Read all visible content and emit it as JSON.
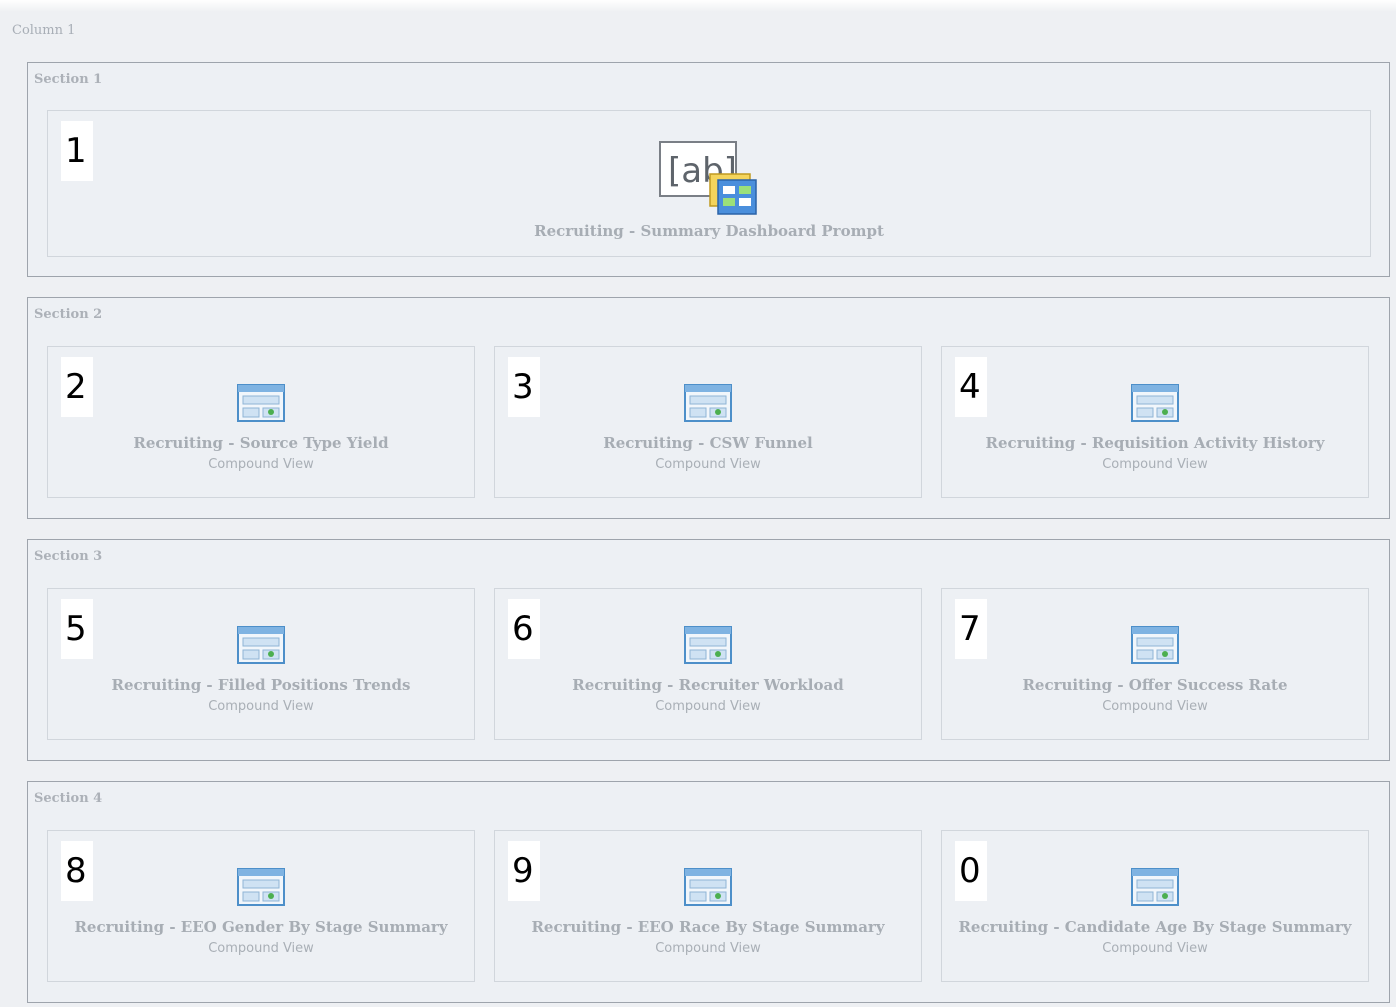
{
  "column": {
    "label": "Column 1"
  },
  "sections": [
    {
      "label": "Section 1",
      "items": [
        {
          "number": "1",
          "title": "Recruiting - Summary Dashboard Prompt",
          "icon": "dashboard-prompt-icon"
        }
      ]
    },
    {
      "label": "Section 2",
      "items": [
        {
          "number": "2",
          "title": "Recruiting - Source Type Yield",
          "subtitle": "Compound View",
          "icon": "compound-view-icon"
        },
        {
          "number": "3",
          "title": "Recruiting - CSW Funnel",
          "subtitle": "Compound View",
          "icon": "compound-view-icon"
        },
        {
          "number": "4",
          "title": "Recruiting - Requisition Activity History",
          "subtitle": "Compound View",
          "icon": "compound-view-icon"
        }
      ]
    },
    {
      "label": "Section 3",
      "items": [
        {
          "number": "5",
          "title": "Recruiting - Filled Positions Trends",
          "subtitle": "Compound View",
          "icon": "compound-view-icon"
        },
        {
          "number": "6",
          "title": "Recruiting - Recruiter Workload",
          "subtitle": "Compound View",
          "icon": "compound-view-icon"
        },
        {
          "number": "7",
          "title": "Recruiting - Offer Success Rate",
          "subtitle": "Compound View",
          "icon": "compound-view-icon"
        }
      ]
    },
    {
      "label": "Section 4",
      "items": [
        {
          "number": "8",
          "title": "Recruiting - EEO Gender By Stage Summary",
          "subtitle": "Compound View",
          "icon": "compound-view-icon"
        },
        {
          "number": "9",
          "title": "Recruiting - EEO Race By Stage Summary",
          "subtitle": "Compound View",
          "icon": "compound-view-icon"
        },
        {
          "number": "0",
          "title": "Recruiting - Candidate Age By Stage Summary",
          "subtitle": "Compound View",
          "icon": "compound-view-icon"
        }
      ]
    }
  ]
}
